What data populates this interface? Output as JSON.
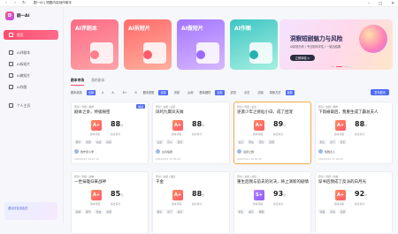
{
  "window": {
    "title": "剧一AI | 短剧内容创作助手"
  },
  "sidebar": {
    "logo_text": "剧一AI",
    "logo_mark": "D",
    "items": [
      {
        "label": "首页",
        "active": true
      },
      {
        "label": "AI评剧本"
      },
      {
        "label": "AI拆短片"
      },
      {
        "label": "AI做短片"
      },
      {
        "label": "AI作图"
      },
      {
        "label": "个人主页"
      }
    ],
    "promo_text": "邀请好友领会员"
  },
  "tools": [
    {
      "name": "AI评剧本"
    },
    {
      "name": "AI拆短片"
    },
    {
      "name": "AI做短片"
    },
    {
      "name": "AI作图"
    }
  ],
  "banner": {
    "title": "洞察短剧魅力与风险",
    "subtitle": "AI精准分析 | 专业剧本评估 | 一键出结果",
    "button": "立即体验 >"
  },
  "tabs": [
    {
      "label": "剧本市场",
      "active": true
    },
    {
      "label": "我的剧本"
    }
  ],
  "filters": {
    "groups": [
      {
        "label": "剧本状态",
        "options": [
          "全部",
          "A",
          "A-",
          "B+",
          "B"
        ]
      },
      {
        "label": "剧本类型",
        "options": [
          "全部",
          "男频",
          "女频"
        ]
      },
      {
        "label": "剧本题材",
        "options": [
          "全部",
          "甜宠",
          "虐恋",
          "逆袭"
        ]
      },
      {
        "label": "排序方式",
        "options": [
          "最新"
        ]
      }
    ],
    "export": "发布剧本"
  },
  "cards": [
    {
      "top": "原创 | 男频 | 都市",
      "title": "剧本之争，终极秘密",
      "grade": "A+",
      "score": "88",
      "score_unit": "分",
      "label1": "剧本评级",
      "label2": "综合得分",
      "tags": [
        "都市",
        "逆袭",
        "商战",
        "情感"
      ],
      "author": "剧作家小李",
      "date": "2024/9/11 14:21:15",
      "badge": "精选"
    },
    {
      "top": "原创 | 女频 | 古装",
      "title": "凤鸣九霄凤天阙",
      "grade": "A+",
      "score": "88",
      "score_unit": "分",
      "label1": "剧本评级",
      "label2": "综合得分",
      "tags": [
        "古装",
        "宫斗",
        "甜宠"
      ],
      "author": "古风编剧",
      "date": "2024/9/11 15:32:20"
    },
    {
      "top": "原创 | 男频 | 玄幻",
      "title": "逆袭少年之修仙小白，成了团宠",
      "grade": "A+",
      "score": "89",
      "score_unit": "分",
      "label1": "剧本评级",
      "label2": "综合得分",
      "tags": [
        "玄幻",
        "修仙",
        "团宠",
        "逆袭"
      ],
      "author": "追梦之剧",
      "date": "2024/9/11 16:01:45",
      "highlight": true
    },
    {
      "top": "原创 | 女频 | 都市",
      "title": "下岗被裁后，我重生成了霸总夫人",
      "grade": "A+",
      "score": "88",
      "score_unit": "分",
      "label1": "剧本评级",
      "label2": "综合得分",
      "tags": [
        "重生",
        "豪门",
        "复仇"
      ],
      "author": "短剧达人",
      "date": "2024/9/11 17:10:08"
    },
    {
      "top": "原创 | 男频 | 战神",
      "title": "一世枭雄归来战神",
      "grade": "A+",
      "score": "85",
      "score_unit": "分",
      "label1": "剧本评级",
      "label2": "综合得分",
      "tags": [
        "战神",
        "都市",
        "热血",
        "逆袭"
      ],
      "author": "",
      "date": ""
    },
    {
      "top": "原创 | 女频 | 甜宠",
      "title": "千金",
      "grade": "A+",
      "score": "88",
      "score_unit": "分",
      "label1": "剧本评级",
      "label2": "综合得分",
      "tags": [
        "甜宠",
        "豪门",
        "虐恋"
      ],
      "author": "",
      "date": ""
    },
    {
      "top": "原创 | 女频 | 虐恋",
      "title": "重生后我与前夫的对决，将上演新的剧情",
      "grade": "S+",
      "score": "93",
      "score_unit": "分",
      "label1": "剧本评级",
      "label2": "综合得分",
      "tags": [
        "重生",
        "虐恋",
        "婚姻"
      ],
      "author": "",
      "date": "",
      "purple": true
    },
    {
      "top": "原创 | 男频 | 穿越",
      "title": "穿书后我成了反派的白月光",
      "grade": "A+",
      "score": "92",
      "score_unit": "分",
      "label1": "剧本评级",
      "label2": "综合得分",
      "tags": [
        "穿越",
        "穿书",
        "逆袭"
      ],
      "author": "",
      "date": ""
    }
  ]
}
